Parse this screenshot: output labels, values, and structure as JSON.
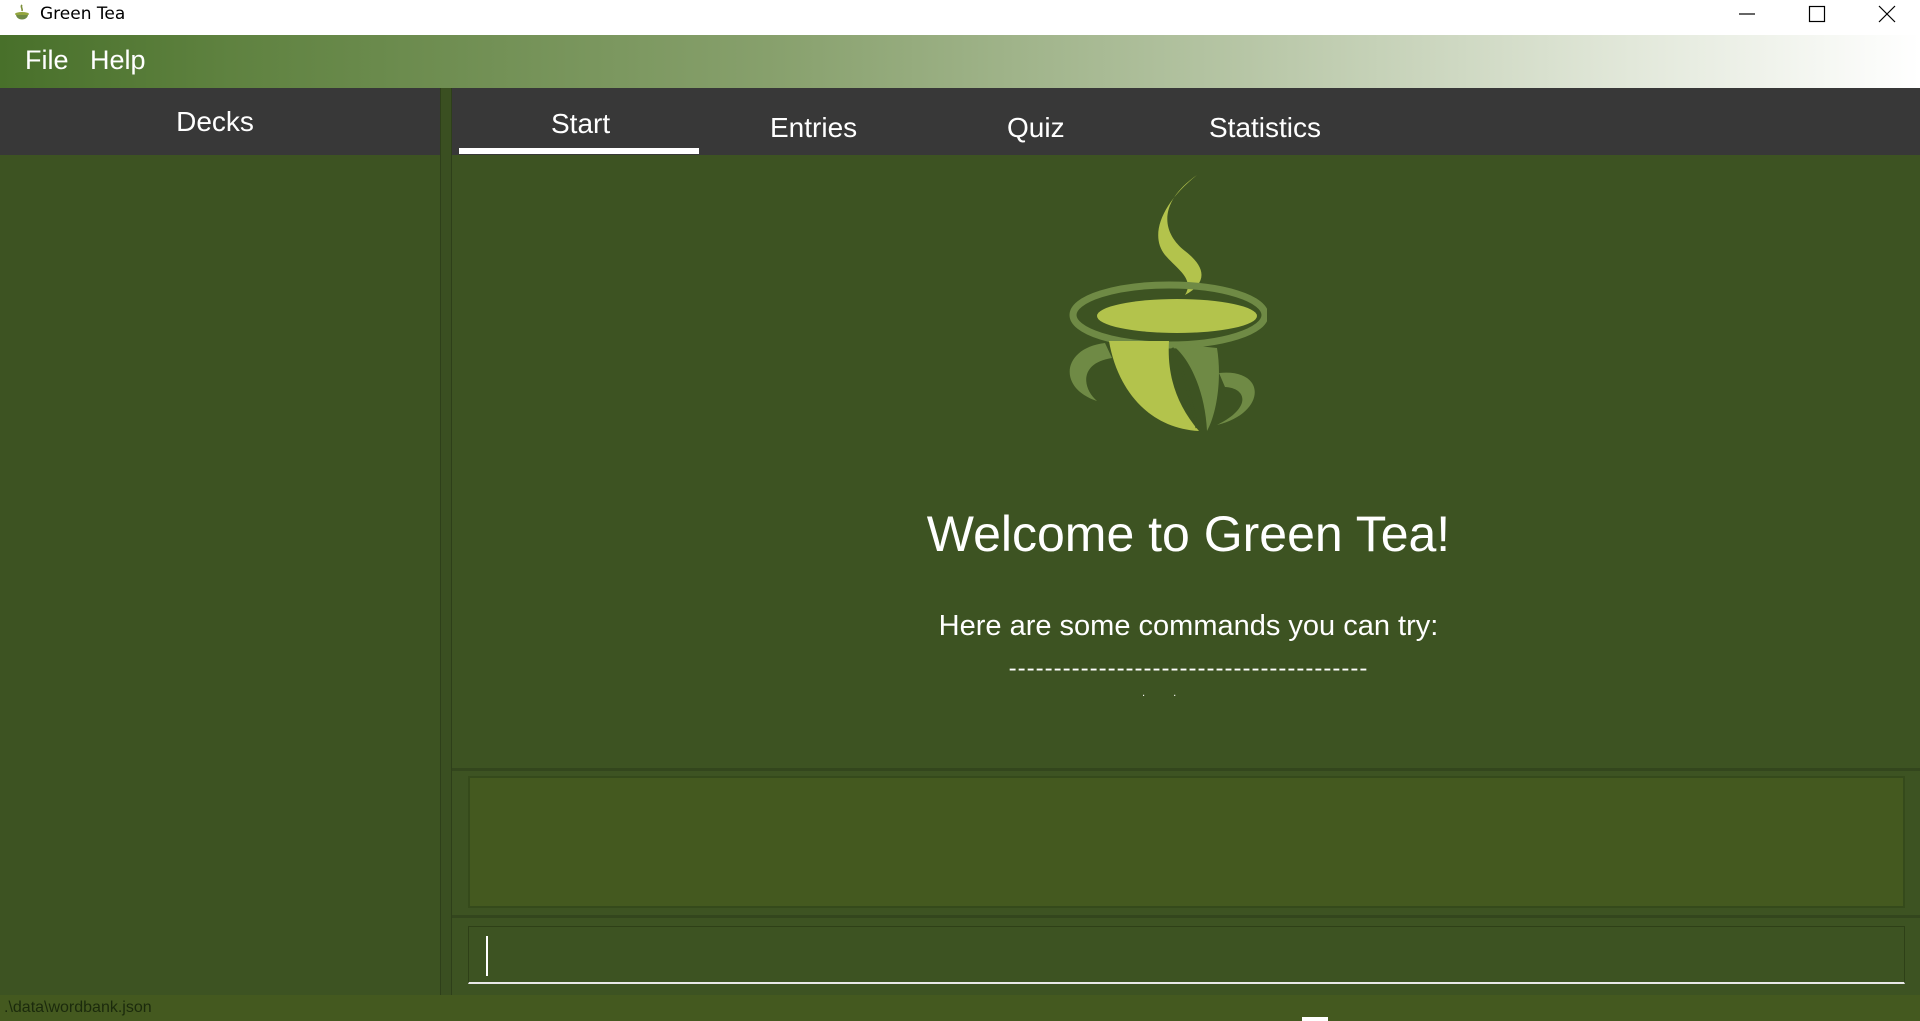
{
  "window": {
    "title": "Green Tea",
    "app_icon": "green-tea-cup-icon"
  },
  "menu": {
    "items": [
      {
        "label": "File"
      },
      {
        "label": "Help"
      }
    ]
  },
  "sidebar": {
    "title": "Decks"
  },
  "tabs": {
    "items": [
      {
        "label": "Start",
        "selected": true
      },
      {
        "label": "Entries",
        "selected": false
      },
      {
        "label": "Quiz",
        "selected": false
      },
      {
        "label": "Statistics",
        "selected": false
      }
    ]
  },
  "start_page": {
    "logo": "green-tea-cup-logo",
    "welcome": "Welcome to Green Tea!",
    "subtitle": "Here are some commands you can try:",
    "separator": "----------------------------------------"
  },
  "result_display": {
    "text": ""
  },
  "command_box": {
    "value": "",
    "placeholder": ""
  },
  "status_bar": {
    "path": ".\\data\\wordbank.json"
  },
  "colors": {
    "background": "#3d5322",
    "header": "#383838",
    "accent_light": "#b3c34c",
    "accent_dark": "#6f8a45"
  }
}
